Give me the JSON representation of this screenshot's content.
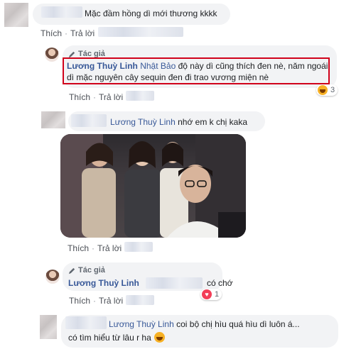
{
  "comment1": {
    "text": "Mặc đầm hồng dì mới thương kkkk"
  },
  "actions": {
    "like": "Thích",
    "reply": "Trả lời",
    "separator": "·"
  },
  "reply1": {
    "badge": "Tác giả",
    "author": "Lương Thuỳ Linh",
    "mention": "Nhật Bảo",
    "text": "độ này dì cũng thích đen nè, năm ngoái dì mặc nguyên cây sequin đen đi trao vương miện nè",
    "reaction_count": "3",
    "highlight_color": "#d0021b"
  },
  "reply2": {
    "mention": "Lương Thuỳ Linh",
    "text": "nhớ em k chị kaka"
  },
  "reply3": {
    "badge": "Tác giả",
    "author": "Lương Thuỳ Linh",
    "text": "có chớ",
    "reaction_count": "1"
  },
  "reply4": {
    "mention": "Lương Thuỳ Linh",
    "text_line1": "coi bộ chị hìu quá hìu dì luôn á...",
    "text_line2": "có tìm hiểu từ lâu r ha"
  },
  "colors": {
    "link": "#385898",
    "bubble": "#f2f3f5",
    "reaction_haha": "#f7b125",
    "reaction_love": "#f33e58"
  }
}
